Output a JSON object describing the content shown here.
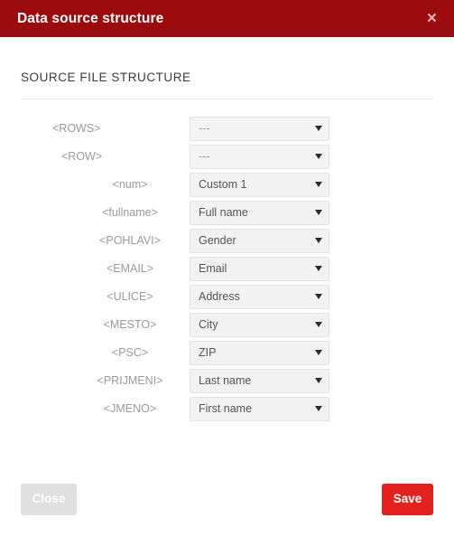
{
  "dialog": {
    "title": "Data source structure",
    "close_icon": "close-icon",
    "close_symbol": "×"
  },
  "section": {
    "heading": "SOURCE FILE STRUCTURE"
  },
  "rows": [
    {
      "label": "<ROWS>",
      "level": 0,
      "value": "---",
      "muted": true
    },
    {
      "label": "<ROW>",
      "level": 1,
      "value": "---",
      "muted": true
    },
    {
      "label": "<num>",
      "level": 2,
      "value": "Custom 1",
      "muted": false
    },
    {
      "label": "<fullname>",
      "level": 2,
      "value": "Full name",
      "muted": false
    },
    {
      "label": "<POHLAVI>",
      "level": 2,
      "value": "Gender",
      "muted": false
    },
    {
      "label": "<EMAIL>",
      "level": 2,
      "value": "Email",
      "muted": false
    },
    {
      "label": "<ULICE>",
      "level": 2,
      "value": "Address",
      "muted": false
    },
    {
      "label": "<MESTO>",
      "level": 2,
      "value": "City",
      "muted": false
    },
    {
      "label": "<PSC>",
      "level": 2,
      "value": "ZIP",
      "muted": false
    },
    {
      "label": "<PRIJMENI>",
      "level": 2,
      "value": "Last name",
      "muted": false
    },
    {
      "label": "<JMENO>",
      "level": 2,
      "value": "First name",
      "muted": false
    }
  ],
  "footer": {
    "close_label": "Close",
    "save_label": "Save"
  },
  "colors": {
    "header_red": "#9b0a0d",
    "save_red": "#e3211f",
    "close_grey": "#e0e0e0",
    "field_grey": "#f2f2f2",
    "label_grey": "#9a9a9a"
  }
}
